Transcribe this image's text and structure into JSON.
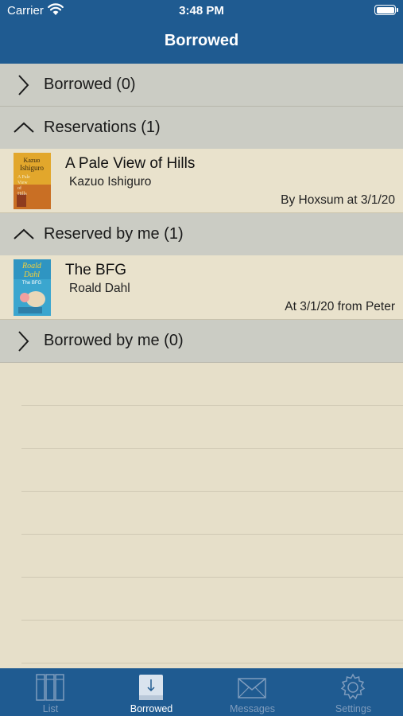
{
  "status": {
    "carrier": "Carrier",
    "time": "3:48 PM"
  },
  "nav": {
    "title": "Borrowed"
  },
  "sections": {
    "borrowed": {
      "label": "Borrowed (0)"
    },
    "reservations": {
      "label": "Reservations (1)"
    },
    "reserved_by_me": {
      "label": "Reserved by me (1)"
    },
    "borrowed_by_me": {
      "label": "Borrowed by me (0)"
    }
  },
  "reservations": [
    {
      "title": "A Pale View of Hills",
      "author": "Kazuo Ishiguro",
      "meta": "By Hoxsum at 3/1/20",
      "cover": {
        "line1": "Kazuo",
        "line2": "Ishiguro",
        "line3": "A Pale",
        "line4": "View",
        "line5": "of",
        "line6": "Hills"
      }
    }
  ],
  "reserved_by_me": [
    {
      "title": "The BFG",
      "author": "Roald Dahl",
      "meta": "At 3/1/20 from Peter",
      "cover": {
        "line1": "Roald",
        "line2": "Dahl",
        "line3": "The BFG"
      }
    }
  ],
  "tabs": [
    {
      "label": "List",
      "icon": "books-icon"
    },
    {
      "label": "Borrowed",
      "icon": "borrowed-download-icon"
    },
    {
      "label": "Messages",
      "icon": "envelope-icon"
    },
    {
      "label": "Settings",
      "icon": "gear-icon"
    }
  ],
  "colors": {
    "bar": "#1f5b91",
    "background": "#e6dfc9",
    "section": "#cbccc4"
  }
}
